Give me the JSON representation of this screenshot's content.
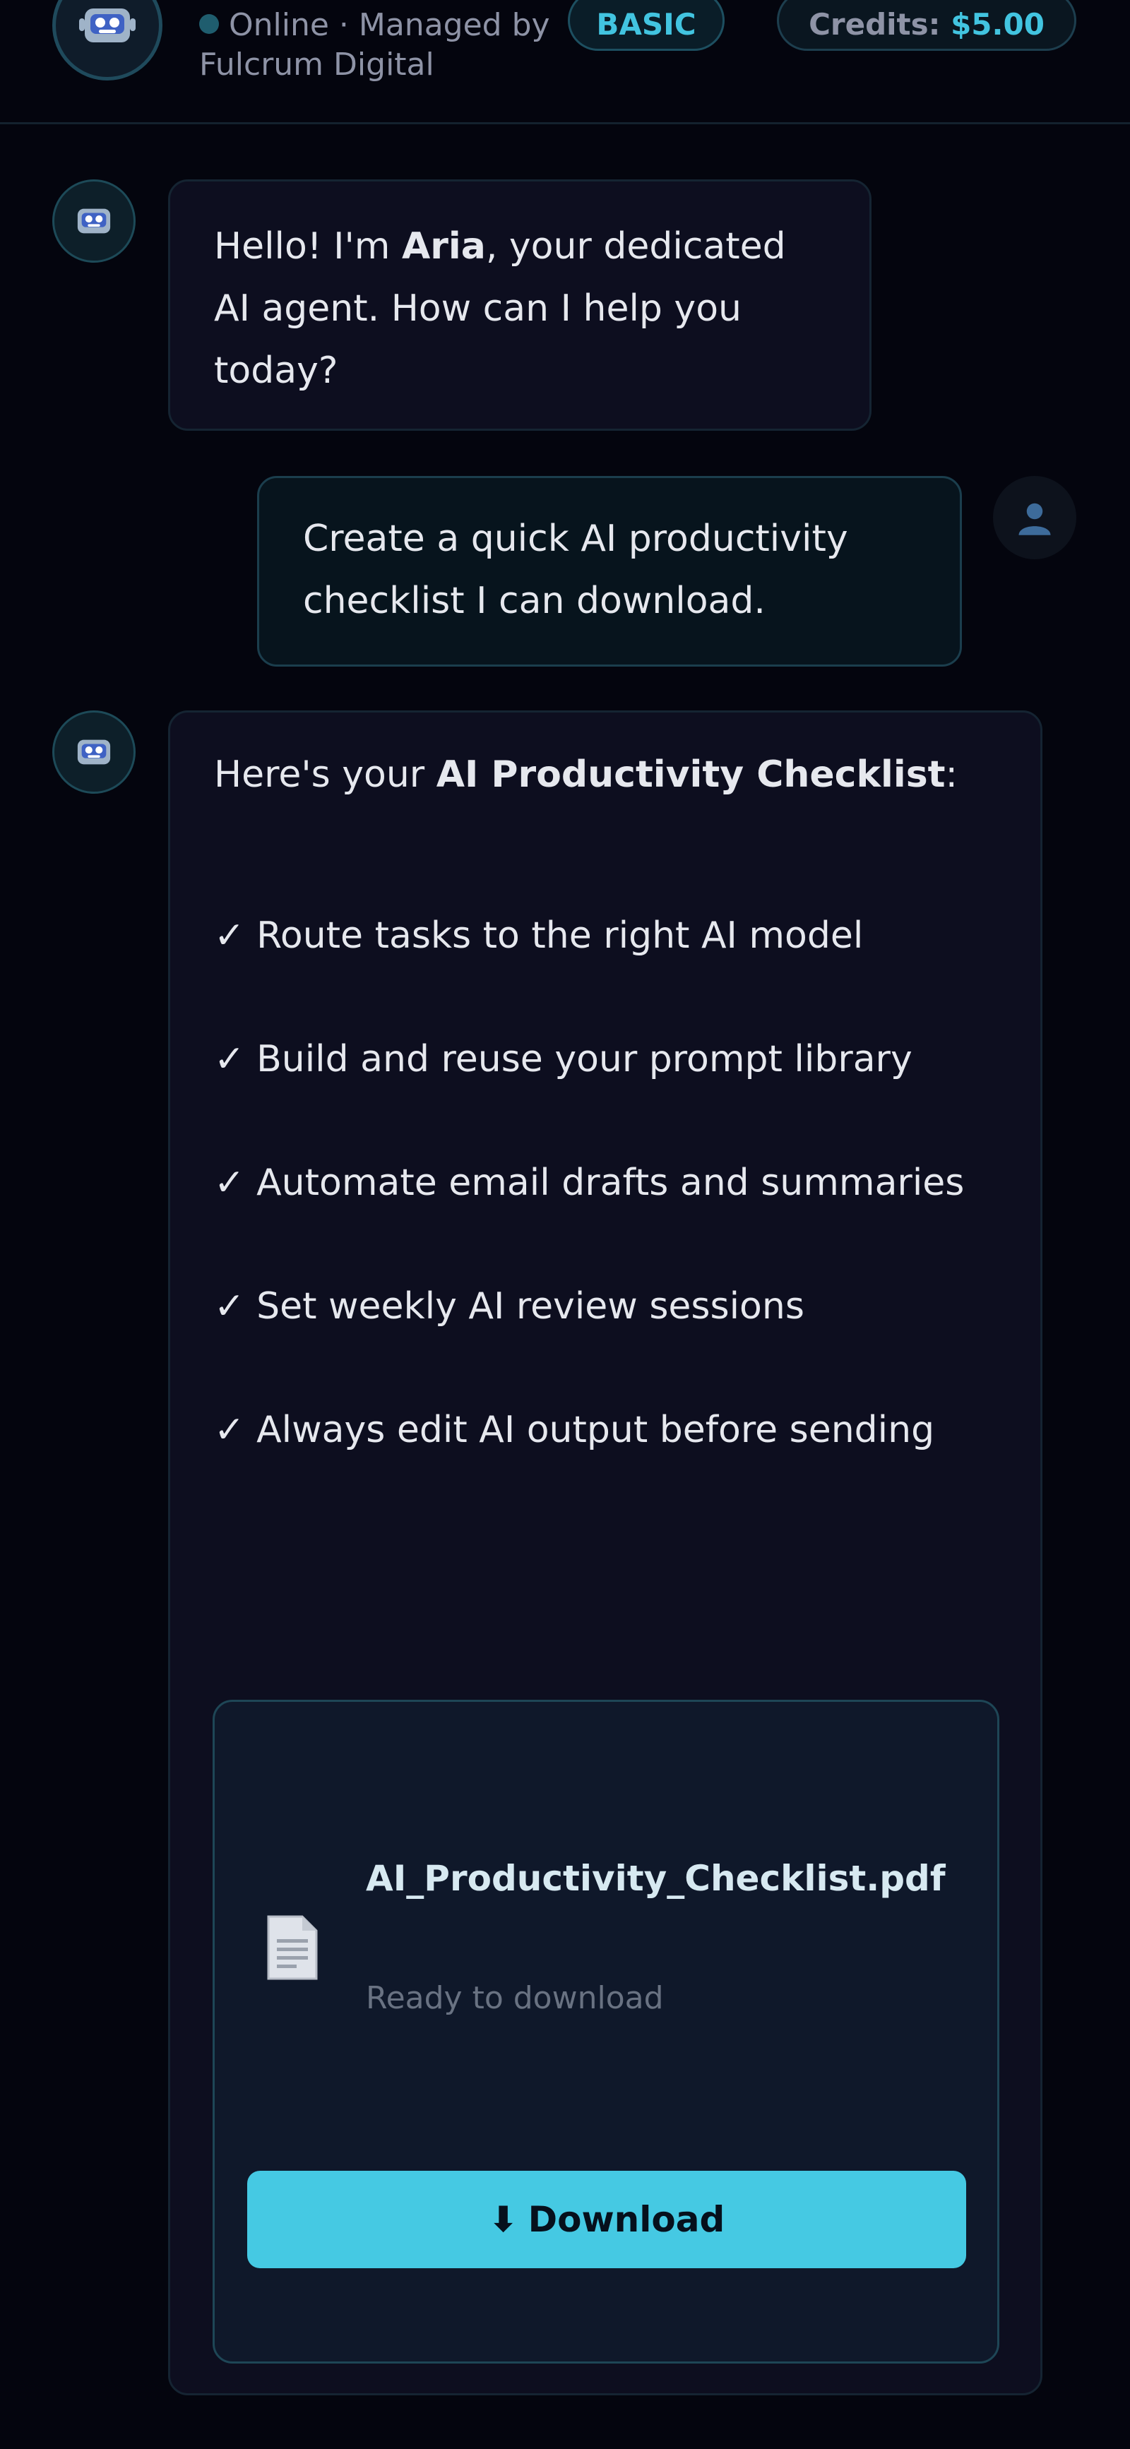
{
  "header": {
    "status": "Online · Managed by Fulcrum Digital",
    "plan": "BASIC",
    "credits_label": "Credits:",
    "credits_value": "$5.00"
  },
  "messages": {
    "greeting": {
      "prefix": "Hello! I'm ",
      "name": "Aria",
      "suffix": ", your dedicated AI agent. How can I help you today?"
    },
    "request": "Create a quick AI productivity checklist I can download.",
    "checklist": {
      "intro_prefix": "Here's your ",
      "intro_title": "AI Productivity Checklist",
      "intro_suffix": ":",
      "items": [
        "✓ Route tasks to the right AI model",
        "✓ Build and reuse your prompt library",
        "✓ Automate email drafts and summaries",
        "✓ Set weekly AI review sessions",
        "✓ Always edit AI output before sending"
      ]
    }
  },
  "file": {
    "name": "AI_Productivity_Checklist.pdf",
    "status": "Ready to download",
    "download_icon": "⬇",
    "download_label": "Download"
  },
  "icons": {
    "bot": "robot-icon",
    "user": "user-icon",
    "file": "document-icon"
  },
  "colors": {
    "accent": "#45c9e3",
    "background": "#04050e",
    "bubble": "#0d0e1f"
  }
}
